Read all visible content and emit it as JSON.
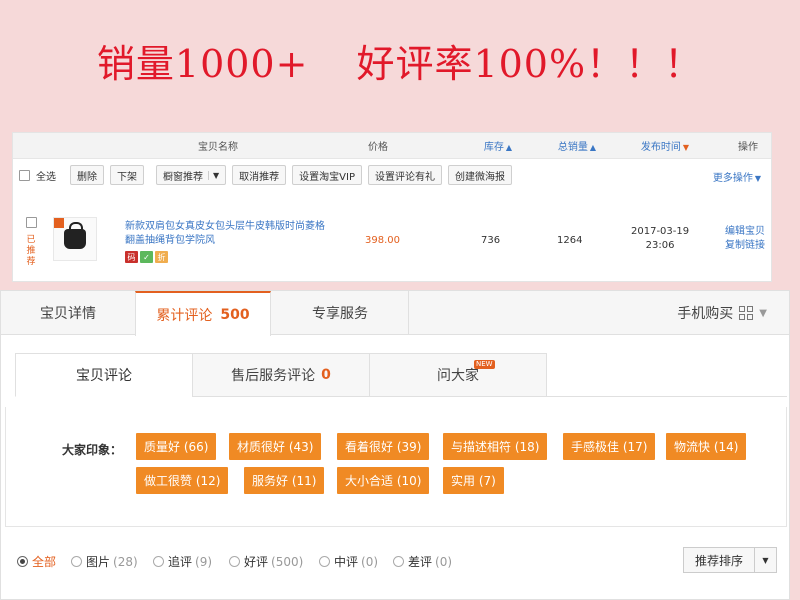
{
  "banner": {
    "sales_text": "销量1000+",
    "rating_text": "好评率100%！！！"
  },
  "seller_table": {
    "headers": {
      "name": "宝贝名称",
      "price": "价格",
      "stock": "库存",
      "total_sales": "总销量",
      "publish_time": "发布时间",
      "actions": "操作"
    },
    "toolbar": {
      "select_all": "全选",
      "delete": "删除",
      "delist": "下架",
      "window_recommend": "橱窗推荐",
      "cancel_recommend": "取消推荐",
      "set_vip": "设置淘宝VIP",
      "set_review_gift": "设置评论有礼",
      "create_poster": "创建微海报",
      "more_ops": "更多操作"
    },
    "product": {
      "status": "已推荐",
      "title": "新款双肩包女真皮女包头层牛皮韩版时尚菱格翻盖抽绳背包学院风",
      "price": "398.00",
      "stock": "736",
      "sales": "1264",
      "date": "2017-03-19",
      "time": "23:06",
      "edit": "编辑宝贝",
      "copy_link": "复制链接",
      "badges": [
        "码",
        "",
        "折"
      ],
      "badge_colors": [
        "#c9302c",
        "#5cb85c",
        "#f0ad4e"
      ]
    }
  },
  "tabs": {
    "details": "宝贝详情",
    "reviews": "累计评论",
    "reviews_count": "500",
    "service": "专享服务",
    "mobile_buy": "手机购买"
  },
  "subtabs": {
    "item_reviews": "宝贝评论",
    "aftersale": "售后服务评论",
    "aftersale_count": "0",
    "ask": "问大家",
    "new_badge": "NEW"
  },
  "impressions": {
    "label": "大家印象：",
    "tags": [
      "质量好 (66)",
      "材质很好 (43)",
      "看着很好 (39)",
      "与描述相符 (18)",
      "手感极佳 (17)",
      "物流快 (14)",
      "做工很赞 (12)",
      "服务好 (11)",
      "大小合适 (10)",
      "实用 (7)"
    ]
  },
  "filters": {
    "items": [
      {
        "label": "全部",
        "count": ""
      },
      {
        "label": "图片",
        "count": "(28)"
      },
      {
        "label": "追评",
        "count": "(9)"
      },
      {
        "label": "好评",
        "count": "(500)"
      },
      {
        "label": "中评",
        "count": "(0)"
      },
      {
        "label": "差评",
        "count": "(0)"
      }
    ],
    "sort": "推荐排序"
  },
  "colors": {
    "accent": "#e3601f",
    "banner": "#e1192a",
    "tag": "#f08a24",
    "link": "#3a76c4"
  }
}
